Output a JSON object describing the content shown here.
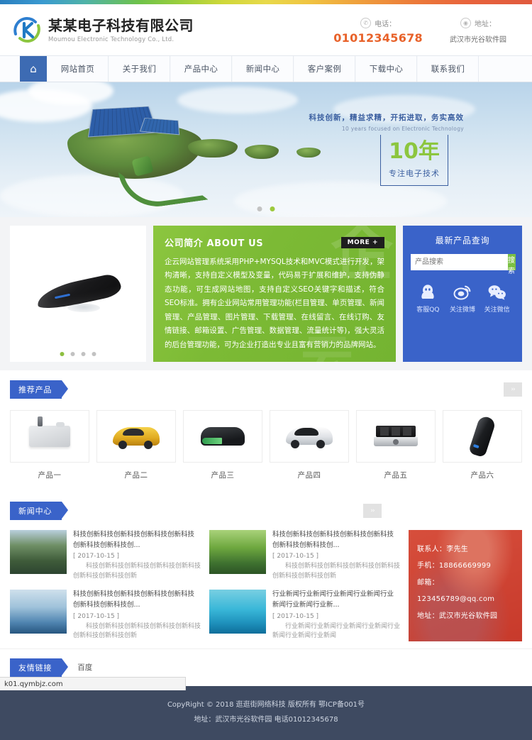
{
  "header": {
    "logo_cn": "某某电子科技有限公司",
    "logo_en": "Moumou Electronic Technology Co., Ltd.",
    "phone_label": "电话：",
    "phone_value": "01012345678",
    "addr_label": "地址：",
    "addr_value": "武汉市光谷软件园"
  },
  "nav": {
    "home_icon": "home-icon",
    "items": [
      {
        "label": "网站首页"
      },
      {
        "label": "关于我们"
      },
      {
        "label": "产品中心"
      },
      {
        "label": "新闻中心"
      },
      {
        "label": "客户案例"
      },
      {
        "label": "下载中心"
      },
      {
        "label": "联系我们"
      }
    ]
  },
  "banner": {
    "slogan_cn": "科技创新，精益求精，开拓进取，务实高效",
    "slogan_en": "10 years focused on Electronic Technology",
    "years": "10年",
    "years_sub": "专注电子技术",
    "dots": 2,
    "active_dot": 1
  },
  "showcase": {
    "product_dots": 4,
    "product_active_dot": 0,
    "about": {
      "title": "公司简介 ABOUT US",
      "more": "MORE +",
      "text": "企云网站管理系统采用PHP+MYSQL技术和MVC模式进行开发，架构清晰，支持自定义模型及变量，代码易于扩展和维护，支持伪静态功能，可生成网站地图，支持自定义SEO关键字和描述，符合SEO标准。拥有企业网站常用管理功能(栏目管理、单页管理、新闻管理、产品管理、图片管理、下载管理、在线留言、在线订购、友情链接、邮箱设置、广告管理、数据管理、流量统计等)，强大灵活的后台管理功能，可为企业打造出专业且富有营销力的品牌网站。",
      "ghost_text": "企",
      "ghost_text2": "云"
    },
    "panel": {
      "title": "最新产品查询",
      "search_placeholder": "产品搜索",
      "search_value": "",
      "search_button": "搜 索",
      "socials": [
        {
          "icon": "qq-penguin-icon",
          "label": "客服QQ"
        },
        {
          "icon": "weibo-eye-icon",
          "label": "关注微博"
        },
        {
          "icon": "wechat-bubble-icon",
          "label": "关注微信"
        }
      ]
    }
  },
  "products": {
    "tag": "推荐产品",
    "arrow_label": "››",
    "items": [
      {
        "name": "产品一",
        "shape": "lab-device"
      },
      {
        "name": "产品二",
        "shape": "gold-car"
      },
      {
        "name": "产品三",
        "shape": "green-box"
      },
      {
        "name": "产品四",
        "shape": "white-car"
      },
      {
        "name": "产品五",
        "shape": "amplifier"
      },
      {
        "name": "产品六",
        "shape": "scanner"
      }
    ]
  },
  "news": {
    "tag": "新闻中心",
    "arrow_label": "››",
    "items": [
      {
        "thumb": "mountain-photo",
        "title": "科技创新科技创新科技创新科技创新科技创新科技创新科技创...",
        "date": "[ 2017-10-15 ]",
        "desc": "科技创新科技创新科技创新科技创新科技创新科技创新科技创新"
      },
      {
        "thumb": "forest-photo",
        "title": "科技创新科技创新科技创新科技创新科技创新科技创新科技创...",
        "date": "[ 2017-10-15 ]",
        "desc": "科技创新科技创新科技创新科技创新科技创新科技创新科技创新"
      },
      {
        "thumb": "ice-photo",
        "title": "科技创新科技创新科技创新科技创新科技创新科技创新科技创...",
        "date": "[ 2017-10-15 ]",
        "desc": "科技创新科技创新科技创新科技创新科技创新科技创新科技创新"
      },
      {
        "thumb": "sea-photo",
        "title": "行业新闻行业新闻行业新闻行业新闻行业新闻行业新闻行业新...",
        "date": "[ 2017-10-15 ]",
        "desc": "行业新闻行业新闻行业新闻行业新闻行业新闻行业新闻行业新闻"
      }
    ],
    "contact": {
      "person": "联系人：李先生",
      "mobile": "手机：18866669999",
      "email": "邮箱：123456789@qq.com",
      "address": "地址：武汉市光谷软件园"
    }
  },
  "links": {
    "tag": "友情链接",
    "items": [
      {
        "label": "百度"
      }
    ]
  },
  "footer": {
    "copyright": "CopyRight © 2018 逛逛街网络科技 版权所有  鄂ICP备001号",
    "contact": "地址：武汉市光谷软件园 电话01012345678"
  },
  "statusbar": {
    "url": "k01.qymbjz.com"
  },
  "colors": {
    "brand_blue": "#3a63c9",
    "nav_blue": "#3d6bb3",
    "green": "#8cc63f",
    "orange": "#e8622a",
    "footer": "#3e4a61",
    "red": "#cd3c2d"
  }
}
